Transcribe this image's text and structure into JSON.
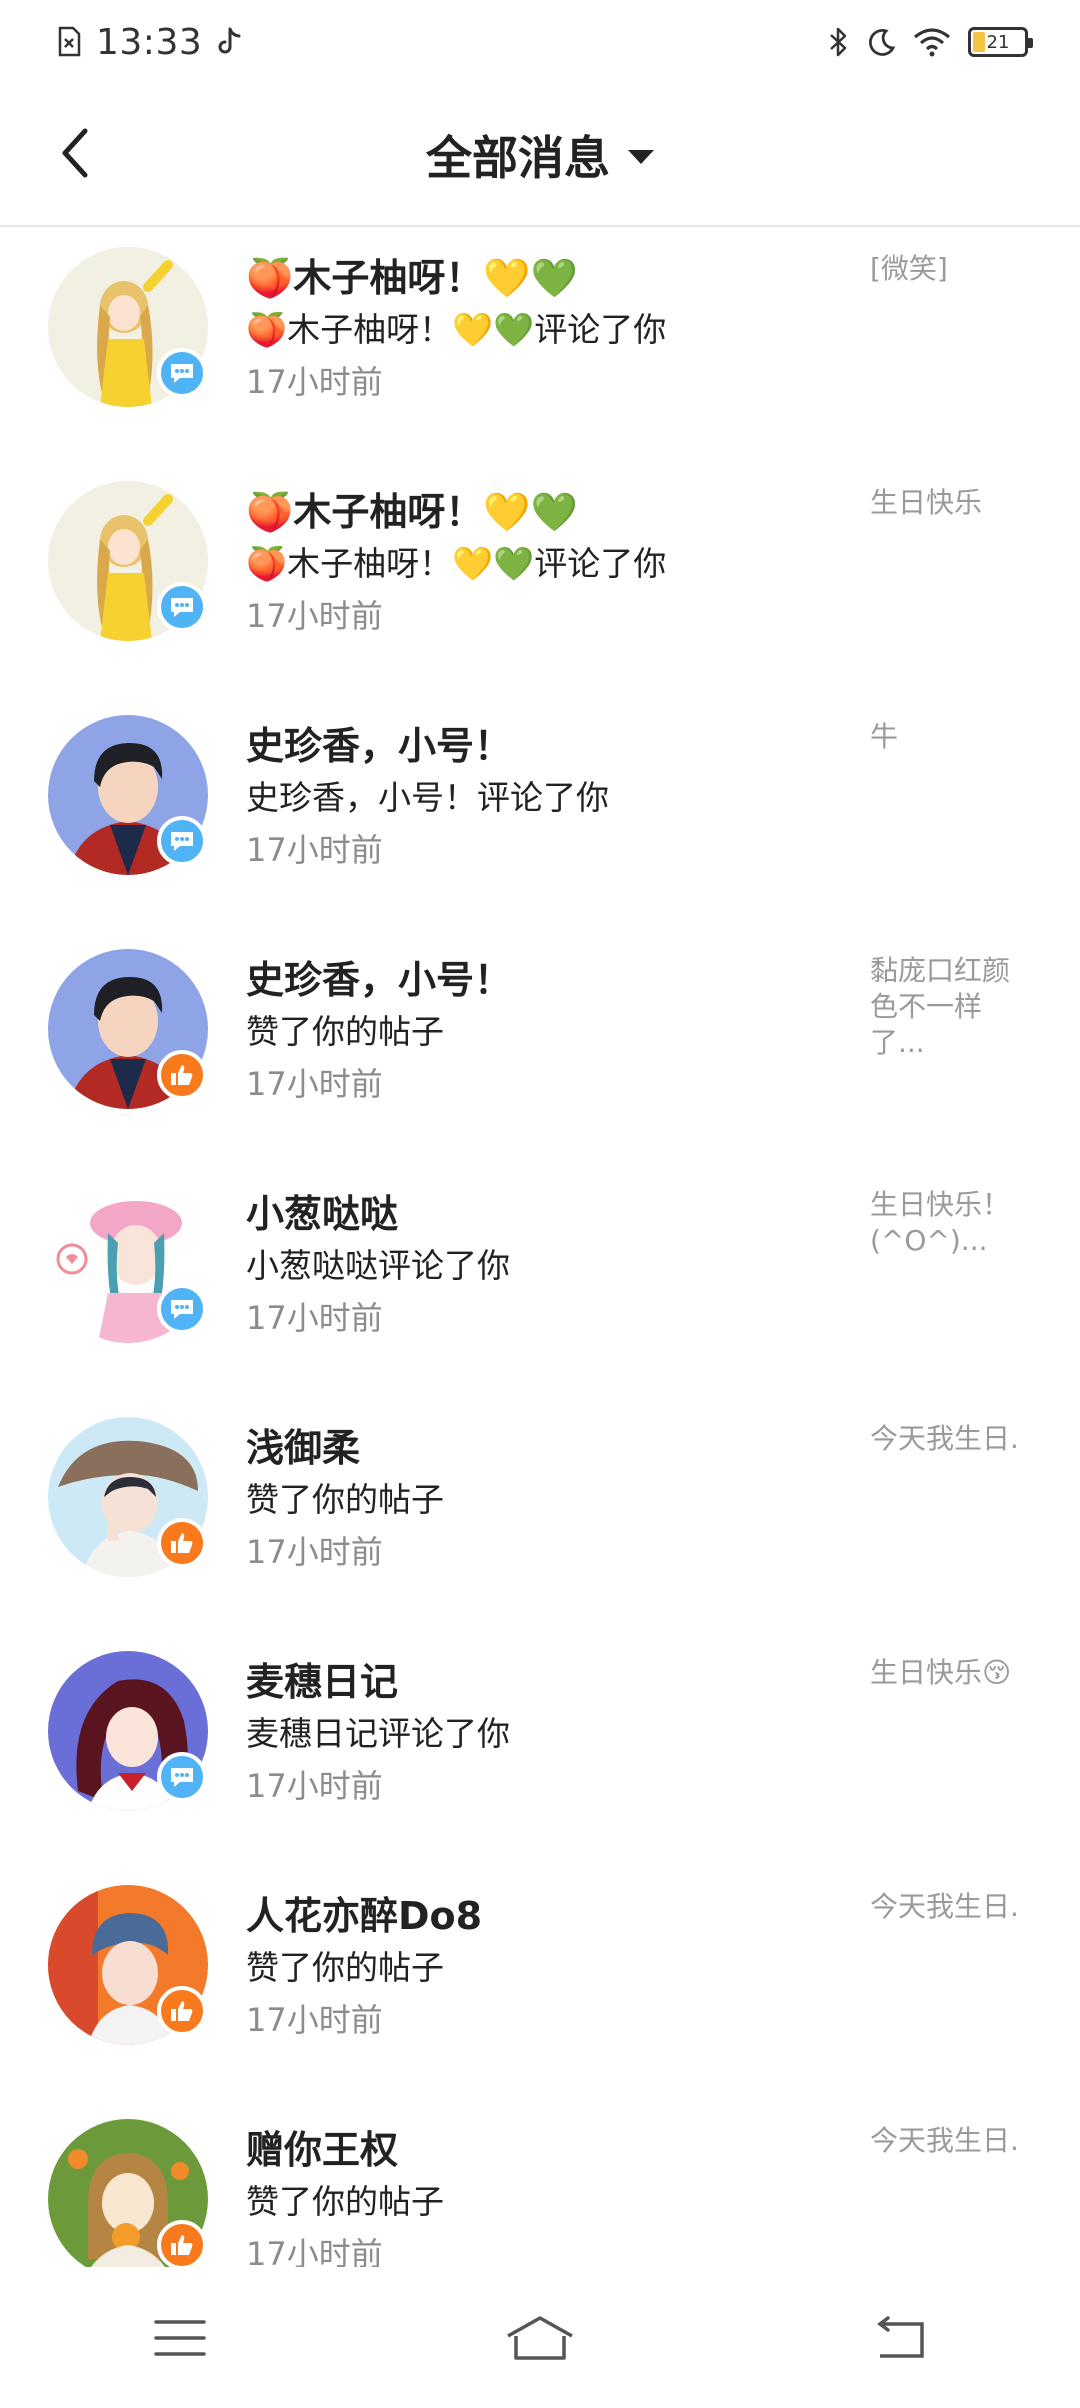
{
  "status_bar": {
    "time": "13:33",
    "battery_level": "21"
  },
  "header": {
    "title": "全部消息"
  },
  "messages": [
    {
      "title": "🍑木子柚呀！💛💚",
      "subtitle": "🍑木子柚呀！💛💚评论了你",
      "time": "17小时前",
      "preview": "[微笑]",
      "type": "comment"
    },
    {
      "title": "🍑木子柚呀！💛💚",
      "subtitle": "🍑木子柚呀！💛💚评论了你",
      "time": "17小时前",
      "preview": "生日快乐",
      "type": "comment"
    },
    {
      "title": "史珍香，小号！",
      "subtitle": "史珍香，小号！评论了你",
      "time": "17小时前",
      "preview": "牛",
      "type": "comment"
    },
    {
      "title": "史珍香，小号！",
      "subtitle": "赞了你的帖子",
      "time": "17小时前",
      "preview": "黏庞口红颜色不一样了...",
      "type": "like"
    },
    {
      "title": "小葱哒哒",
      "subtitle": "小葱哒哒评论了你",
      "time": "17小时前",
      "preview": "生日快乐！(^O^)...",
      "type": "comment"
    },
    {
      "title": "浅御柔",
      "subtitle": "赞了你的帖子",
      "time": "17小时前",
      "preview": "今天我生日.",
      "type": "like"
    },
    {
      "title": "麦穗日记",
      "subtitle": "麦穗日记评论了你",
      "time": "17小时前",
      "preview": "生日快乐😚",
      "type": "comment"
    },
    {
      "title": "人花亦醉Do8",
      "subtitle": "赞了你的帖子",
      "time": "17小时前",
      "preview": "今天我生日.",
      "type": "like"
    },
    {
      "title": "赠你王权",
      "subtitle": "赞了你的帖子",
      "time": "17小时前",
      "preview": "今天我生日.",
      "type": "like"
    }
  ],
  "colors": {
    "comment_badge": "#4fb3f6",
    "like_badge": "#f87a1c",
    "time_text": "#8c8c8c",
    "preview_text": "#9a9a9a"
  }
}
